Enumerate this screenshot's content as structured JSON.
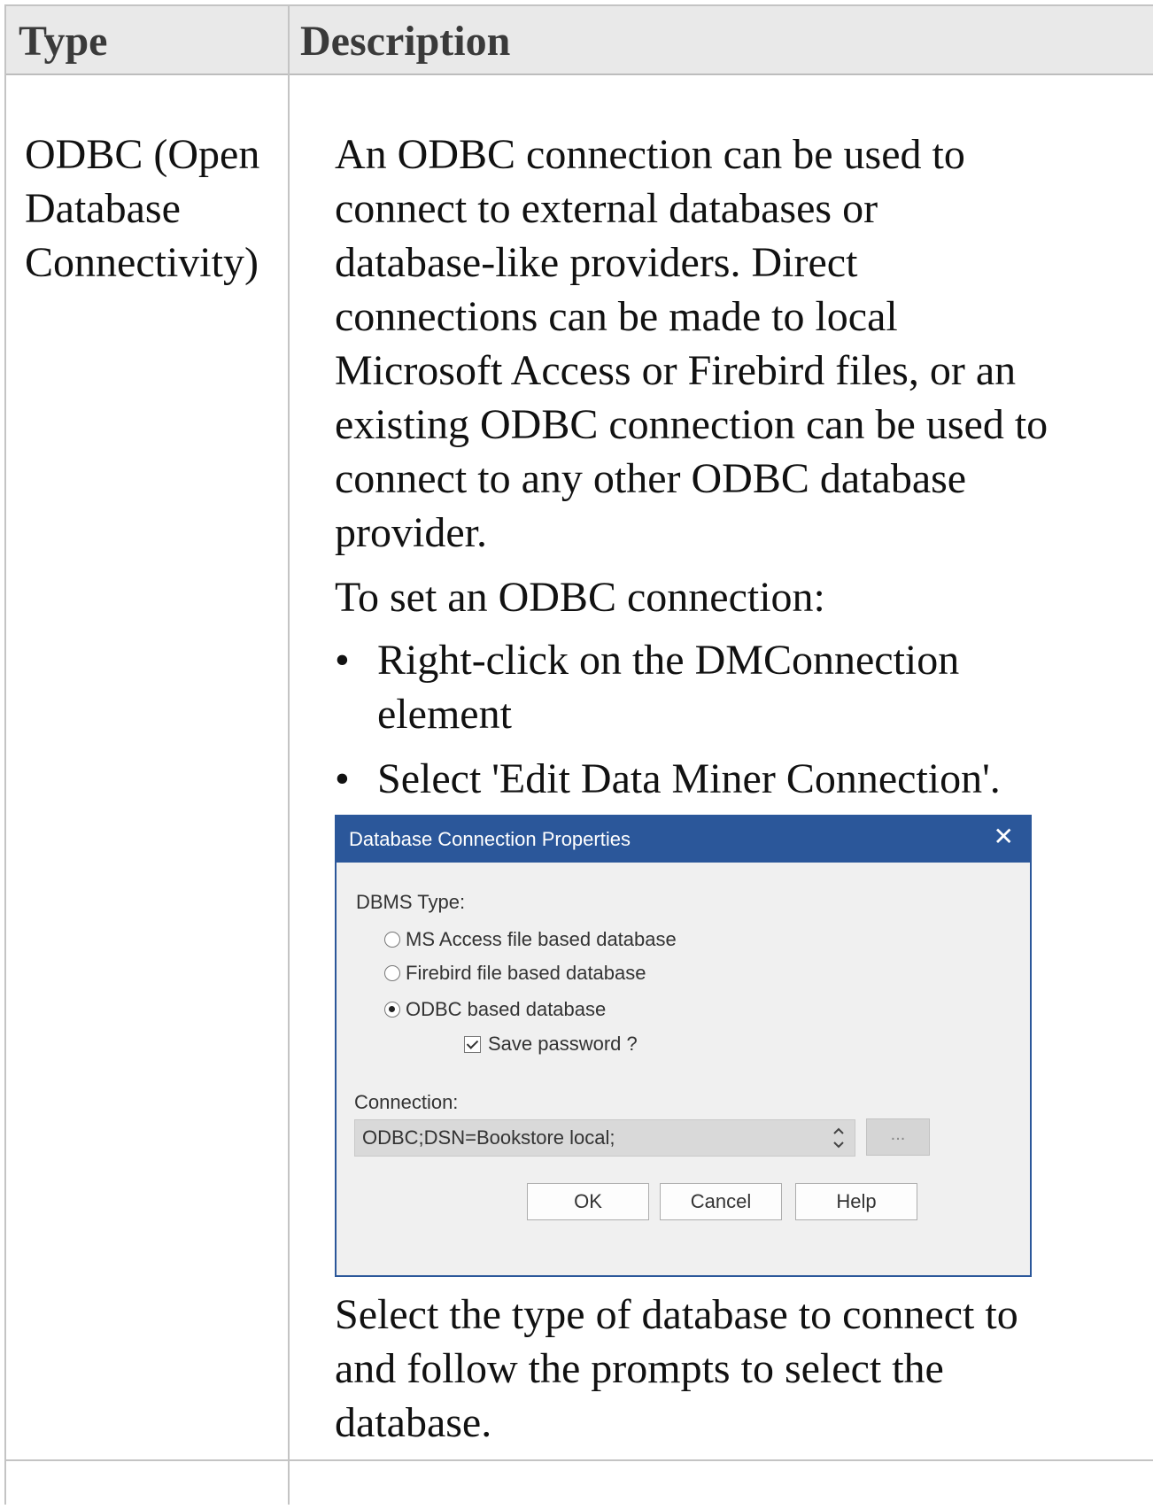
{
  "table": {
    "headers": {
      "type": "Type",
      "description": "Description"
    },
    "row": {
      "type_lines": [
        "ODBC (Open",
        "Database",
        "Connectivity)"
      ],
      "description_lines": [
        "An ODBC connection can be used to",
        "connect to external databases or",
        "database-like providers. Direct",
        "connections can be made to local",
        "Microsoft Access or Firebird files, or an",
        "existing ODBC connection can be used to",
        "connect to any other ODBC database",
        "provider."
      ],
      "setup_intro": "To set an ODBC connection:",
      "bullets": [
        {
          "lines": [
            "Right-click on the DMConnection",
            "element"
          ]
        },
        {
          "lines": [
            "Select 'Edit Data Miner Connection'."
          ]
        }
      ],
      "closing_lines": [
        "Select the type of database to connect to",
        "and follow the prompts to select the",
        "database."
      ]
    }
  },
  "dialog": {
    "title": "Database Connection Properties",
    "close_glyph": "✕",
    "dbms_label": "DBMS Type:",
    "options": [
      {
        "label": "MS Access file based database",
        "selected": false
      },
      {
        "label": "Firebird file based database",
        "selected": false
      },
      {
        "label": "ODBC based database",
        "selected": true
      }
    ],
    "save_password_label": "Save password ?",
    "save_password_checked": true,
    "connection_label": "Connection:",
    "connection_value": "ODBC;DSN=Bookstore local;",
    "browse_label": "...",
    "buttons": {
      "ok": "OK",
      "cancel": "Cancel",
      "help": "Help"
    },
    "colors": {
      "title_bar": "#2b579a",
      "body": "#f0f0f0"
    }
  },
  "bullet_glyph": "•"
}
